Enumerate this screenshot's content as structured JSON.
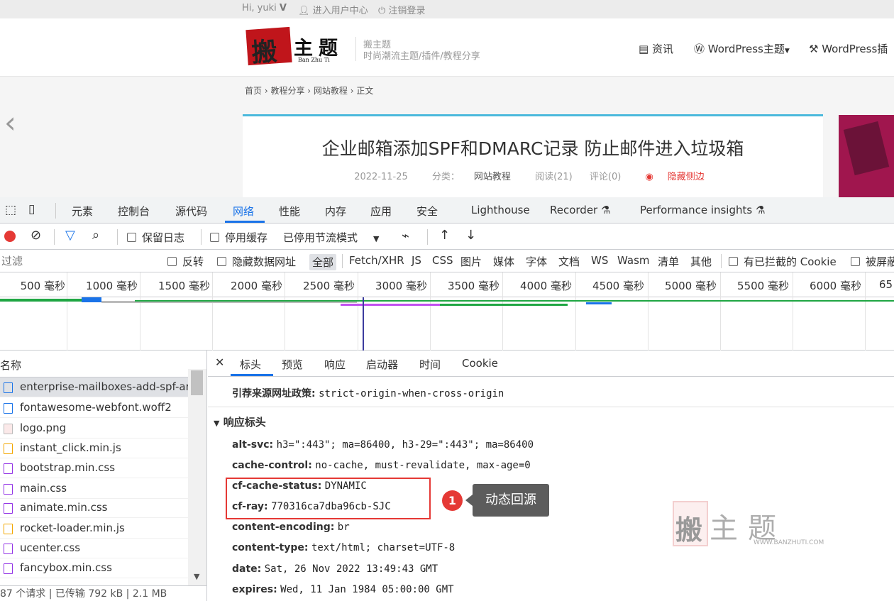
{
  "site": {
    "topbar": {
      "greeting": "Hi, yuki",
      "greeting_icon": "V",
      "user_center": "进入用户中心",
      "logout": "注销登录"
    },
    "logo": {
      "mark": "搬",
      "main": "主题",
      "en": "Ban Zhu Ti"
    },
    "name": "搬主题",
    "tagline": "时尚潮流主题/插件/教程分享",
    "nav": [
      "资讯",
      "WordPress主题",
      "WordPress插"
    ],
    "breadcrumb": [
      "首页",
      "教程分享",
      "网站教程",
      "正文"
    ],
    "article": {
      "title": "企业邮箱添加SPF和DMARC记录 防止邮件进入垃圾箱",
      "date": "2022-11-25",
      "category_label": "分类：",
      "category": "网站教程",
      "reads": "阅读(21)",
      "comments": "评论(0)",
      "hide_sidebar": "隐藏侧边"
    }
  },
  "devtools": {
    "tabs": [
      "元素",
      "控制台",
      "源代码",
      "网络",
      "性能",
      "内存",
      "应用",
      "安全",
      "Lighthouse",
      "Recorder",
      "Performance insights"
    ],
    "active_tab": "网络",
    "toolbar": {
      "preserve_log": "保留日志",
      "disable_cache": "停用缓存",
      "throttling": "已停用节流模式"
    },
    "filter": {
      "placeholder": "过滤",
      "invert": "反转",
      "hide_data_urls": "隐藏数据网址",
      "types": [
        "全部",
        "Fetch/XHR",
        "JS",
        "CSS",
        "图片",
        "媒体",
        "字体",
        "文档",
        "WS",
        "Wasm",
        "清单",
        "其他"
      ],
      "blocked_cookies": "有已拦截的 Cookie",
      "blocked_requests": "被屏蔽"
    },
    "timeline_ticks": [
      "500 毫秒",
      "1000 毫秒",
      "1500 毫秒",
      "2000 毫秒",
      "2500 毫秒",
      "3000 毫秒",
      "3500 毫秒",
      "4000 毫秒",
      "4500 毫秒",
      "5000 毫秒",
      "5500 毫秒",
      "6000 毫秒",
      "65"
    ],
    "name_header": "名称",
    "files": [
      {
        "name": "enterprise-mailboxes-add-spf-an",
        "icon": "document-icon",
        "color": "#1a73e8"
      },
      {
        "name": "fontawesome-webfont.woff2",
        "icon": "font-icon",
        "color": "#1a73e8"
      },
      {
        "name": "logo.png",
        "icon": "image-icon",
        "color": "#c0151b"
      },
      {
        "name": "instant_click.min.js",
        "icon": "script-icon",
        "color": "#f2a600"
      },
      {
        "name": "bootstrap.min.css",
        "icon": "stylesheet-icon",
        "color": "#9334e6"
      },
      {
        "name": "main.css",
        "icon": "stylesheet-icon",
        "color": "#9334e6"
      },
      {
        "name": "animate.min.css",
        "icon": "stylesheet-icon",
        "color": "#9334e6"
      },
      {
        "name": "rocket-loader.min.js",
        "icon": "script-icon",
        "color": "#f2a600"
      },
      {
        "name": "ucenter.css",
        "icon": "stylesheet-icon",
        "color": "#9334e6"
      },
      {
        "name": "fancybox.min.css",
        "icon": "stylesheet-icon",
        "color": "#9334e6"
      }
    ],
    "status": {
      "requests": "87 个请求",
      "transferred": "已传输 792 kB",
      "resources": "2.1 MB"
    },
    "detail_tabs": [
      "标头",
      "预览",
      "响应",
      "启动器",
      "时间",
      "Cookie"
    ],
    "active_detail_tab": "标头",
    "referrer_policy": {
      "name": "引荐来源网址政策:",
      "value": "strict-origin-when-cross-origin"
    },
    "response_headers_title": "响应标头",
    "response_headers": [
      {
        "name": "alt-svc:",
        "value": "h3=\":443\"; ma=86400, h3-29=\":443\"; ma=86400"
      },
      {
        "name": "cache-control:",
        "value": "no-cache, must-revalidate, max-age=0"
      },
      {
        "name": "cf-cache-status:",
        "value": "DYNAMIC"
      },
      {
        "name": "cf-ray:",
        "value": "770316ca7dba96cb-SJC"
      },
      {
        "name": "content-encoding:",
        "value": "br"
      },
      {
        "name": "content-type:",
        "value": "text/html; charset=UTF-8"
      },
      {
        "name": "date:",
        "value": "Sat, 26 Nov 2022 13:49:43 GMT"
      },
      {
        "name": "expires:",
        "value": "Wed, 11 Jan 1984 05:00:00 GMT"
      }
    ]
  },
  "annotation": {
    "number": "1",
    "text": "动态回源"
  },
  "watermark": {
    "mark": "搬",
    "text": "主题",
    "url": "WWW.BANZHUTI.COM"
  },
  "colors": {
    "accent": "#1a73e8",
    "highlight": "#e53935",
    "callout": "#5c5c5c"
  }
}
